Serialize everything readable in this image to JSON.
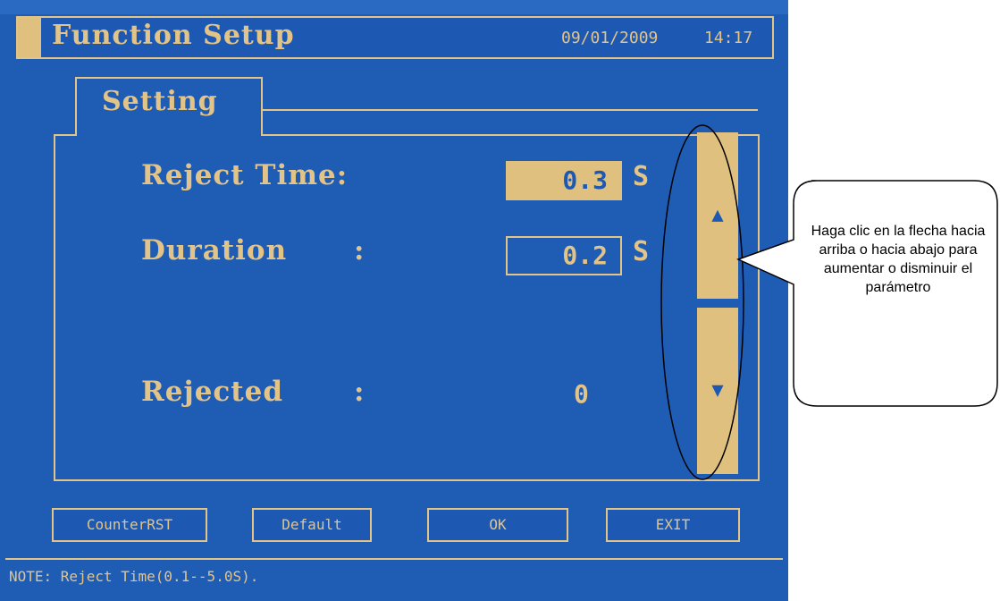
{
  "header": {
    "title": "Function Setup",
    "date": "09/01/2009",
    "time": "14:17"
  },
  "tab": {
    "label": "Setting"
  },
  "fields": {
    "reject_time": {
      "label": "Reject Time:",
      "value": "0.3",
      "unit": "S"
    },
    "duration": {
      "label": "Duration",
      "colon": ":",
      "value": "0.2",
      "unit": "S"
    },
    "rejected": {
      "label": "Rejected",
      "colon": ":",
      "value": "0"
    }
  },
  "arrows": {
    "up_icon": "up-arrow-icon",
    "down_icon": "down-arrow-icon"
  },
  "buttons": {
    "counter_rst": "CounterRST",
    "default": "Default",
    "ok": "OK",
    "exit": "EXIT"
  },
  "note": "NOTE: Reject  Time(0.1--5.0S).",
  "callout": "Haga clic en la flecha hacia arriba o hacia abajo para aumentar o disminuir el parámetro",
  "colors": {
    "screen": "#1f5cb4",
    "accent": "#e0c07e"
  }
}
